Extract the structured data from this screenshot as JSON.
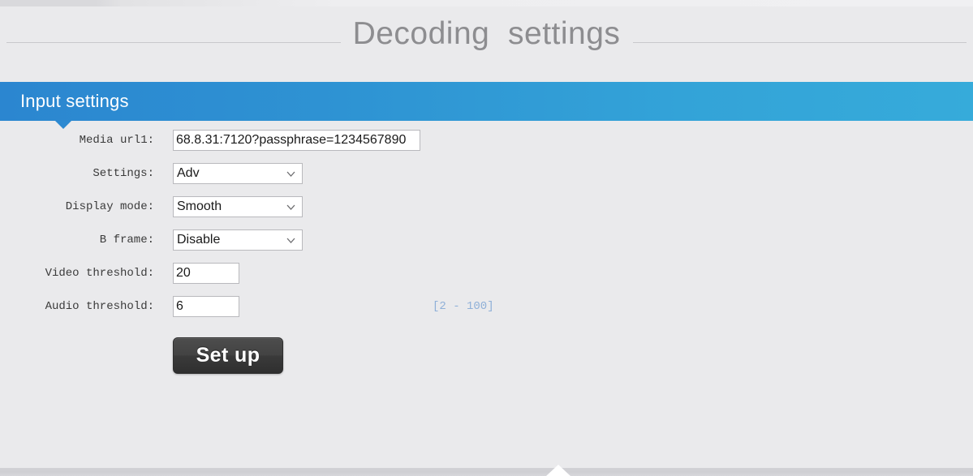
{
  "page": {
    "title": "Decoding  settings",
    "background_color": "#eaeaec",
    "title_color": "#8d8d90"
  },
  "section": {
    "header_title": "Input settings",
    "accent_color_left": "#2b86d0",
    "accent_color_right": "#36abda"
  },
  "form": {
    "rows": [
      {
        "label": "Media url1:",
        "type": "text",
        "value": "68.8.31:7120?passphrase=1234567890",
        "placeholder": ""
      },
      {
        "label": "Settings:",
        "type": "select",
        "value": "Adv"
      },
      {
        "label": "Display mode:",
        "type": "select",
        "value": "Smooth"
      },
      {
        "label": "B frame:",
        "type": "select",
        "value": "Disable"
      },
      {
        "label": "Video threshold:",
        "type": "text",
        "value": "20",
        "placeholder": ""
      },
      {
        "label": "Audio threshold:",
        "type": "text",
        "value": "6",
        "placeholder": "",
        "hint": "[2 - 100]",
        "hint_color": "#8fb0d8"
      }
    ],
    "submit_label": "Set up"
  },
  "icons": {
    "chevron_down": "chevron-down-icon",
    "section_pointer": "triangle-down-icon",
    "bottom_pointer": "triangle-up-icon"
  }
}
